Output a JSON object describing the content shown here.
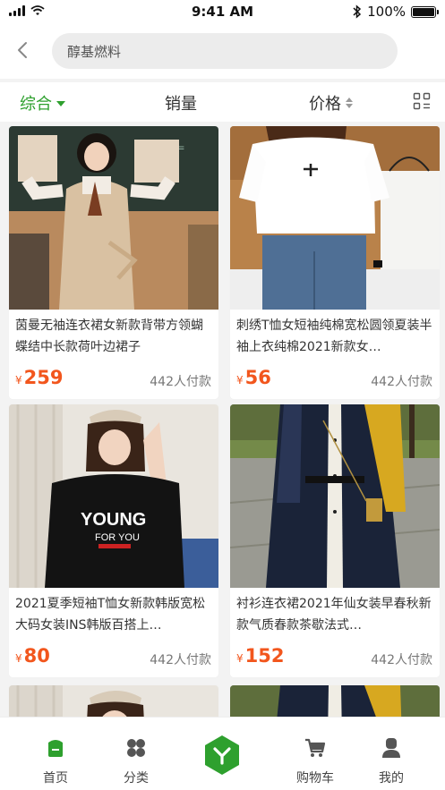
{
  "status_bar": {
    "time": "9:41 AM",
    "battery_text": "100%",
    "battery_level": 1.0
  },
  "search": {
    "query": "醇基燃料"
  },
  "sort_bar": {
    "items": [
      {
        "label": "综合",
        "active": true
      },
      {
        "label": "销量",
        "active": false
      },
      {
        "label": "价格",
        "active": false
      }
    ]
  },
  "products": [
    {
      "title": "茵曼无袖连衣裙女新款背带方领蝴蝶结中长款荷叶边裙子",
      "currency": "¥",
      "price": "259",
      "sold": "442人付款"
    },
    {
      "title": "刺绣T恤女短袖纯棉宽松圆领夏装半袖上衣纯棉2021新款女…",
      "currency": "¥",
      "price": "56",
      "sold": "442人付款"
    },
    {
      "title": "2021夏季短袖T恤女新款韩版宽松大码女装INS韩版百搭上…",
      "currency": "¥",
      "price": "80",
      "sold": "442人付款"
    },
    {
      "title": "衬衫连衣裙2021年仙女装早春秋新款气质春款茶歇法式…",
      "currency": "¥",
      "price": "152",
      "sold": "442人付款"
    }
  ],
  "tab_bar": {
    "items": [
      {
        "label": "首页",
        "icon": "home-icon",
        "active": true
      },
      {
        "label": "分类",
        "icon": "category-icon",
        "active": false
      },
      {
        "label": "",
        "icon": "center-action-icon",
        "active": false
      },
      {
        "label": "购物车",
        "icon": "cart-icon",
        "active": false
      },
      {
        "label": "我的",
        "icon": "profile-icon",
        "active": false
      }
    ]
  },
  "colors": {
    "accent": "#2ea02e",
    "price": "#f2561d",
    "background": "#f3f3f3"
  }
}
